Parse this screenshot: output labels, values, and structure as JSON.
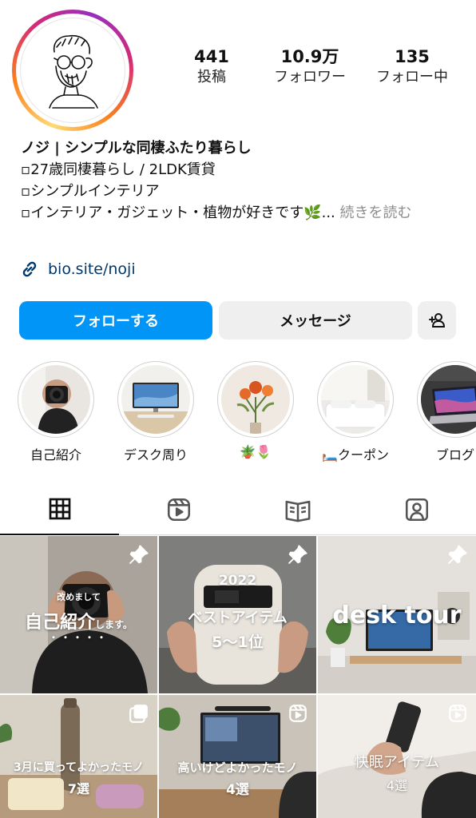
{
  "profile": {
    "stats": [
      {
        "num": "441",
        "label": "投稿"
      },
      {
        "num": "10.9万",
        "label": "フォロワー"
      },
      {
        "num": "135",
        "label": "フォロー中"
      }
    ],
    "name": "ノジ | シンプルな同棲ふたり暮らし",
    "bio_lines": [
      "▫27歳同棲暮らし / 2LDK賃貸",
      "▫シンプルインテリア",
      "▫インテリア・ガジェット・植物が好きです🌿..."
    ],
    "bio_more": "続きを読む",
    "link": "bio.site/noji"
  },
  "buttons": {
    "follow": "フォローする",
    "message": "メッセージ",
    "add_user_icon": "person-add-icon"
  },
  "highlights": [
    {
      "label": "自己紹介"
    },
    {
      "label": "デスク周り"
    },
    {
      "label": "🪴🌷"
    },
    {
      "label": "🛏️クーポン"
    },
    {
      "label": "ブログ"
    }
  ],
  "tabs": [
    {
      "name": "grid",
      "icon": "grid-icon"
    },
    {
      "name": "reels",
      "icon": "reels-icon"
    },
    {
      "name": "guides",
      "icon": "guide-book-icon"
    },
    {
      "name": "tagged",
      "icon": "tagged-person-icon"
    }
  ],
  "posts": [
    {
      "caption_small": "改めまして",
      "caption": "自己紹介",
      "caption_tail": "します。",
      "dots": "・・・・・",
      "badge": "pin-icon"
    },
    {
      "caption_year": "2022",
      "caption": "ベストアイテム",
      "caption_sub": "5〜1位",
      "badge": "pin-icon"
    },
    {
      "caption": "desk tour",
      "badge": "pin-icon"
    },
    {
      "caption": "3月に買ってよかったモノ",
      "caption_sub": "7選",
      "badge": "carousel-icon"
    },
    {
      "caption": "高いけどよかったモノ",
      "caption_sub": "4選",
      "badge": "reel-icon"
    },
    {
      "caption": "快眠アイテム",
      "caption_sub": "4選",
      "badge": "reel-icon"
    }
  ],
  "colors": {
    "follow": "#0095f6",
    "link": "#00376b",
    "muted": "#8e8e8e"
  }
}
